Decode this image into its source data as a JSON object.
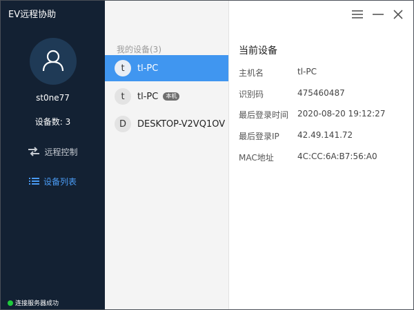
{
  "app": {
    "title": "EV远程协助"
  },
  "sidebar": {
    "username": "st0ne77",
    "device_count": "设备数: 3",
    "nav": [
      {
        "label": "远程控制",
        "icon": "swap-arrows-icon",
        "active": false
      },
      {
        "label": "设备列表",
        "icon": "list-icon",
        "active": true
      }
    ],
    "status": {
      "text": "连接服务器成功",
      "color": "#1fcb3c"
    }
  },
  "device_list": {
    "group_header": "我的设备(3)",
    "devices": [
      {
        "letter": "t",
        "name": "tl-PC",
        "tag": "",
        "selected": true
      },
      {
        "letter": "t",
        "name": "tl-PC",
        "tag": "本机",
        "selected": false
      },
      {
        "letter": "D",
        "name": "DESKTOP-V2VQ1OV",
        "tag": "",
        "selected": false
      }
    ]
  },
  "detail": {
    "title": "当前设备",
    "fields": [
      {
        "key": "主机名",
        "value": "tl-PC"
      },
      {
        "key": "识别码",
        "value": "475460487"
      },
      {
        "key": "最后登录时间",
        "value": "2020-08-20 19:12:27"
      },
      {
        "key": "最后登录IP",
        "value": "42.49.141.72"
      },
      {
        "key": "MAC地址",
        "value": "4C:CC:6A:B7:56:A0"
      }
    ]
  },
  "colors": {
    "sidebar_bg": "#132133",
    "accent": "#4096f0",
    "nav_active": "#4a9cf5"
  },
  "window_controls": [
    "menu-icon",
    "minimize-icon",
    "close-icon"
  ]
}
